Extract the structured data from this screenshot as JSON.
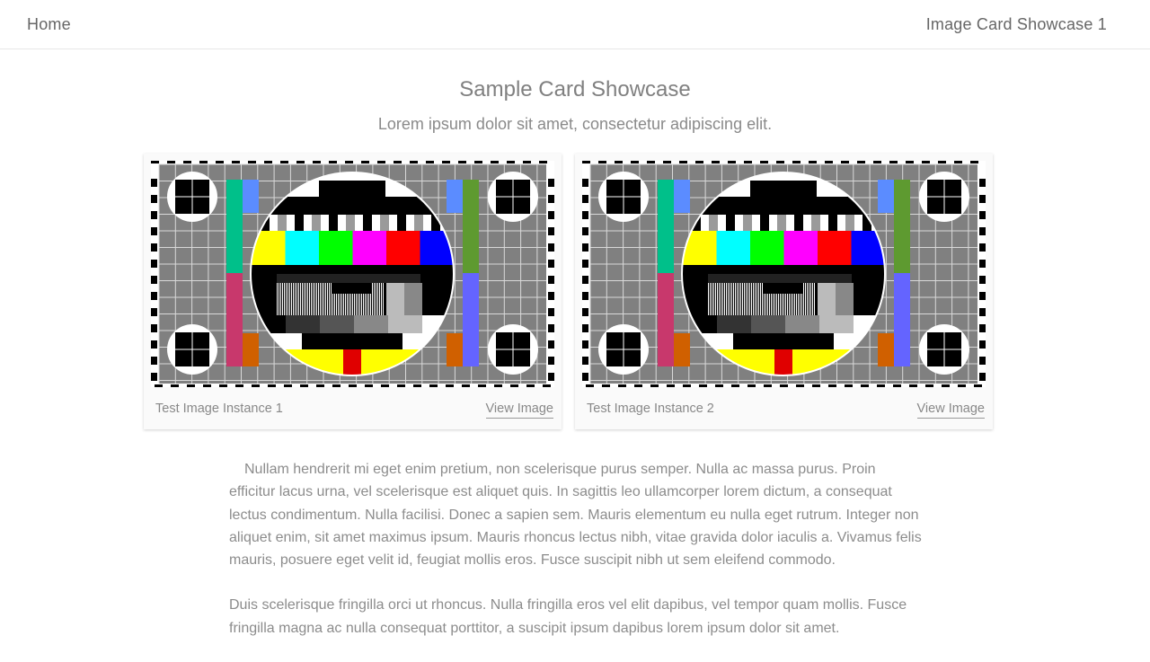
{
  "nav": {
    "home": "Home",
    "title": "Image Card Showcase 1"
  },
  "header": {
    "title": "Sample Card Showcase",
    "subtitle": "Lorem ipsum dolor sit amet, consectetur adipiscing elit."
  },
  "cards": [
    {
      "caption": "Test Image Instance 1",
      "link": "View Image"
    },
    {
      "caption": "Test Image Instance 2",
      "link": "View Image"
    }
  ],
  "content": {
    "paragraph_1": "Nullam hendrerit mi eget enim pretium, non scelerisque purus semper. Nulla ac massa purus. Proin efficitur lacus urna, vel scelerisque est aliquet quis. In sagittis leo ullamcorper lorem dictum, a consequat lectus condimentum. Nulla facilisi. Donec a sapien sem. Mauris elementum eu nulla eget rutrum. Integer non aliquet enim, sit amet maximus ipsum. Mauris rhoncus lectus nibh, vitae gravida dolor iaculis a. Vivamus felis mauris, posuere eget velit id, feugiat mollis eros. Fusce suscipit nibh ut sem eleifend commodo.",
    "paragraph_2": "Duis scelerisque fringilla orci ut rhoncus. Nulla fringilla eros vel elit dapibus, vel tempor quam mollis. Fusce fringilla magna ac nulla consequat porttitor, a suscipit ipsum dapibus lorem ipsum dolor sit amet."
  },
  "test_pattern_colors": [
    "#ffff00",
    "#00ffff",
    "#00ff00",
    "#ff00ff",
    "#ff0000",
    "#0000ff"
  ]
}
